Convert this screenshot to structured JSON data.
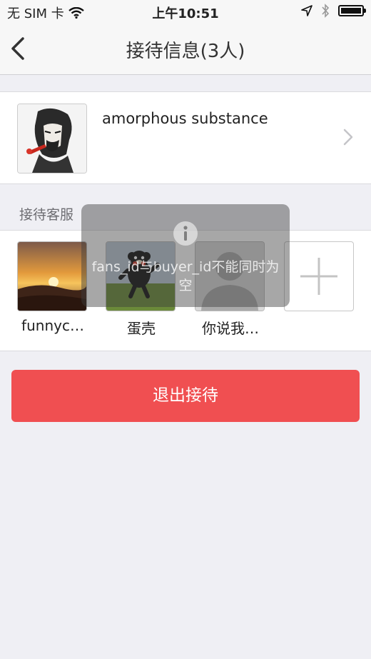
{
  "status_bar": {
    "carrier": "无 SIM 卡",
    "time": "上午10:51"
  },
  "nav": {
    "title": "接待信息(3人)"
  },
  "user": {
    "name": "amorphous substance"
  },
  "staff_section": {
    "label": "接待客服",
    "members": [
      {
        "name": "funnyc…"
      },
      {
        "name": "蛋壳"
      },
      {
        "name": "你说我…"
      }
    ]
  },
  "exit_button": {
    "label": "退出接待"
  },
  "toast": {
    "message": "fans_id与buyer_id不能同时为空"
  },
  "colors": {
    "accent_red": "#f04f51",
    "background": "#efeff4"
  }
}
